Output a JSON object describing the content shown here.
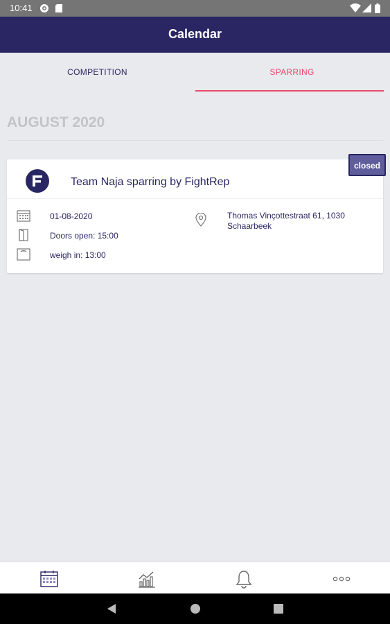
{
  "status_bar": {
    "time": "10:41",
    "icons": [
      "settings-gear-icon",
      "sd-card-icon",
      "wifi-icon",
      "cell-signal-icon",
      "battery-icon"
    ]
  },
  "app_bar": {
    "title": "Calendar"
  },
  "tabs": [
    {
      "label": "COMPETITION",
      "selected": false
    },
    {
      "label": "SPARRING",
      "selected": true
    }
  ],
  "month_header": "AUGUST 2020",
  "event": {
    "title": "Team Naja sparring by FightRep",
    "status": "closed",
    "date": "01-08-2020",
    "doors": "Doors open: 15:00",
    "weigh_in": "weigh in: 13:00",
    "address_line1": "Thomas Vinçottestraat 61, 1030",
    "address_line2": "Schaarbeek"
  },
  "bottom_nav": [
    "calendar-icon",
    "statistics-icon",
    "notifications-bell-icon",
    "more-icon"
  ],
  "colors": {
    "primary": "#2a2663",
    "accent": "#e64a6a",
    "background": "#e9eaee",
    "badge": "#5f5d9b"
  }
}
